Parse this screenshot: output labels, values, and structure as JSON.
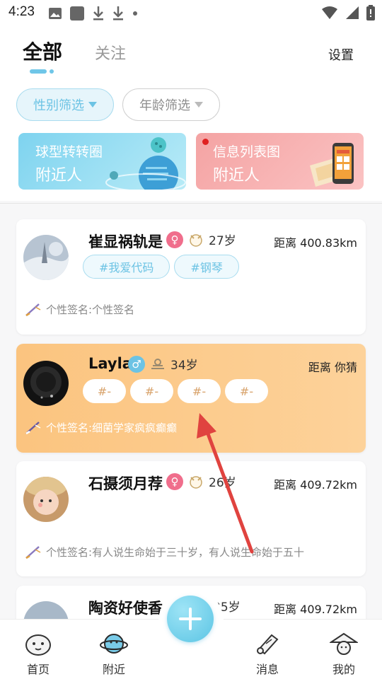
{
  "status_bar": {
    "time": "4:23"
  },
  "header": {
    "tab_all": "全部",
    "tab_follow": "关注",
    "settings": "设置"
  },
  "filters": {
    "gender": "性别筛选",
    "age": "年龄筛选"
  },
  "banners": [
    {
      "line1": "球型转转圈",
      "line2": "附近人"
    },
    {
      "line1": "信息列表图",
      "line2": "附近人"
    }
  ],
  "users": [
    {
      "name": "崔显祸轨是",
      "gender": "♀",
      "age": "27岁",
      "distance": "距离 400.83km",
      "tags": [
        "#我爱代码",
        "#钢琴"
      ],
      "signature": "个性签名:个性签名"
    },
    {
      "name": "Layla",
      "gender": "♂",
      "age": "34岁",
      "distance": "距离 你猜",
      "tags": [
        "#-",
        "#-",
        "#-",
        "#-"
      ],
      "signature": "个性签名:细菌学家疯疯癫癫"
    },
    {
      "name": "石摄须月荐",
      "gender": "♀",
      "age": "26岁",
      "distance": "距离 409.72km",
      "tags": [],
      "signature": "个性签名:有人说生命始于三十岁，有人说生命始于五十"
    },
    {
      "name": "陶资好使香",
      "gender": "",
      "age": "35岁",
      "distance": "距离 409.72km",
      "tags": [],
      "signature": ""
    }
  ],
  "nav": {
    "home": "首页",
    "nearby": "附近",
    "messages": "消息",
    "mine": "我的"
  },
  "colors": {
    "accent": "#6cc3e4",
    "highlight_card": "#fbc47f",
    "female": "#f06e8c",
    "male": "#6cc3e4",
    "arrow": "#e0433f"
  }
}
